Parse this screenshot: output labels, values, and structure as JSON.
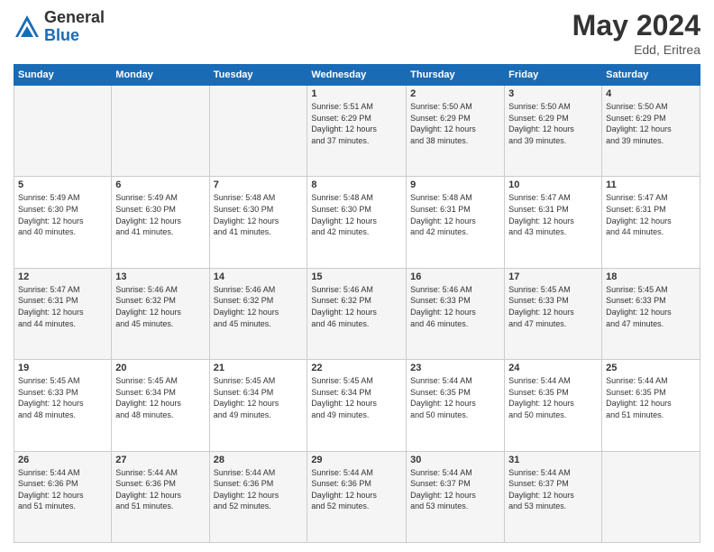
{
  "header": {
    "logo_general": "General",
    "logo_blue": "Blue",
    "title": "May 2024",
    "location": "Edd, Eritrea"
  },
  "days_of_week": [
    "Sunday",
    "Monday",
    "Tuesday",
    "Wednesday",
    "Thursday",
    "Friday",
    "Saturday"
  ],
  "weeks": [
    [
      {
        "day": "",
        "info": ""
      },
      {
        "day": "",
        "info": ""
      },
      {
        "day": "",
        "info": ""
      },
      {
        "day": "1",
        "info": "Sunrise: 5:51 AM\nSunset: 6:29 PM\nDaylight: 12 hours\nand 37 minutes."
      },
      {
        "day": "2",
        "info": "Sunrise: 5:50 AM\nSunset: 6:29 PM\nDaylight: 12 hours\nand 38 minutes."
      },
      {
        "day": "3",
        "info": "Sunrise: 5:50 AM\nSunset: 6:29 PM\nDaylight: 12 hours\nand 39 minutes."
      },
      {
        "day": "4",
        "info": "Sunrise: 5:50 AM\nSunset: 6:29 PM\nDaylight: 12 hours\nand 39 minutes."
      }
    ],
    [
      {
        "day": "5",
        "info": "Sunrise: 5:49 AM\nSunset: 6:30 PM\nDaylight: 12 hours\nand 40 minutes."
      },
      {
        "day": "6",
        "info": "Sunrise: 5:49 AM\nSunset: 6:30 PM\nDaylight: 12 hours\nand 41 minutes."
      },
      {
        "day": "7",
        "info": "Sunrise: 5:48 AM\nSunset: 6:30 PM\nDaylight: 12 hours\nand 41 minutes."
      },
      {
        "day": "8",
        "info": "Sunrise: 5:48 AM\nSunset: 6:30 PM\nDaylight: 12 hours\nand 42 minutes."
      },
      {
        "day": "9",
        "info": "Sunrise: 5:48 AM\nSunset: 6:31 PM\nDaylight: 12 hours\nand 42 minutes."
      },
      {
        "day": "10",
        "info": "Sunrise: 5:47 AM\nSunset: 6:31 PM\nDaylight: 12 hours\nand 43 minutes."
      },
      {
        "day": "11",
        "info": "Sunrise: 5:47 AM\nSunset: 6:31 PM\nDaylight: 12 hours\nand 44 minutes."
      }
    ],
    [
      {
        "day": "12",
        "info": "Sunrise: 5:47 AM\nSunset: 6:31 PM\nDaylight: 12 hours\nand 44 minutes."
      },
      {
        "day": "13",
        "info": "Sunrise: 5:46 AM\nSunset: 6:32 PM\nDaylight: 12 hours\nand 45 minutes."
      },
      {
        "day": "14",
        "info": "Sunrise: 5:46 AM\nSunset: 6:32 PM\nDaylight: 12 hours\nand 45 minutes."
      },
      {
        "day": "15",
        "info": "Sunrise: 5:46 AM\nSunset: 6:32 PM\nDaylight: 12 hours\nand 46 minutes."
      },
      {
        "day": "16",
        "info": "Sunrise: 5:46 AM\nSunset: 6:33 PM\nDaylight: 12 hours\nand 46 minutes."
      },
      {
        "day": "17",
        "info": "Sunrise: 5:45 AM\nSunset: 6:33 PM\nDaylight: 12 hours\nand 47 minutes."
      },
      {
        "day": "18",
        "info": "Sunrise: 5:45 AM\nSunset: 6:33 PM\nDaylight: 12 hours\nand 47 minutes."
      }
    ],
    [
      {
        "day": "19",
        "info": "Sunrise: 5:45 AM\nSunset: 6:33 PM\nDaylight: 12 hours\nand 48 minutes."
      },
      {
        "day": "20",
        "info": "Sunrise: 5:45 AM\nSunset: 6:34 PM\nDaylight: 12 hours\nand 48 minutes."
      },
      {
        "day": "21",
        "info": "Sunrise: 5:45 AM\nSunset: 6:34 PM\nDaylight: 12 hours\nand 49 minutes."
      },
      {
        "day": "22",
        "info": "Sunrise: 5:45 AM\nSunset: 6:34 PM\nDaylight: 12 hours\nand 49 minutes."
      },
      {
        "day": "23",
        "info": "Sunrise: 5:44 AM\nSunset: 6:35 PM\nDaylight: 12 hours\nand 50 minutes."
      },
      {
        "day": "24",
        "info": "Sunrise: 5:44 AM\nSunset: 6:35 PM\nDaylight: 12 hours\nand 50 minutes."
      },
      {
        "day": "25",
        "info": "Sunrise: 5:44 AM\nSunset: 6:35 PM\nDaylight: 12 hours\nand 51 minutes."
      }
    ],
    [
      {
        "day": "26",
        "info": "Sunrise: 5:44 AM\nSunset: 6:36 PM\nDaylight: 12 hours\nand 51 minutes."
      },
      {
        "day": "27",
        "info": "Sunrise: 5:44 AM\nSunset: 6:36 PM\nDaylight: 12 hours\nand 51 minutes."
      },
      {
        "day": "28",
        "info": "Sunrise: 5:44 AM\nSunset: 6:36 PM\nDaylight: 12 hours\nand 52 minutes."
      },
      {
        "day": "29",
        "info": "Sunrise: 5:44 AM\nSunset: 6:36 PM\nDaylight: 12 hours\nand 52 minutes."
      },
      {
        "day": "30",
        "info": "Sunrise: 5:44 AM\nSunset: 6:37 PM\nDaylight: 12 hours\nand 53 minutes."
      },
      {
        "day": "31",
        "info": "Sunrise: 5:44 AM\nSunset: 6:37 PM\nDaylight: 12 hours\nand 53 minutes."
      },
      {
        "day": "",
        "info": ""
      }
    ]
  ]
}
